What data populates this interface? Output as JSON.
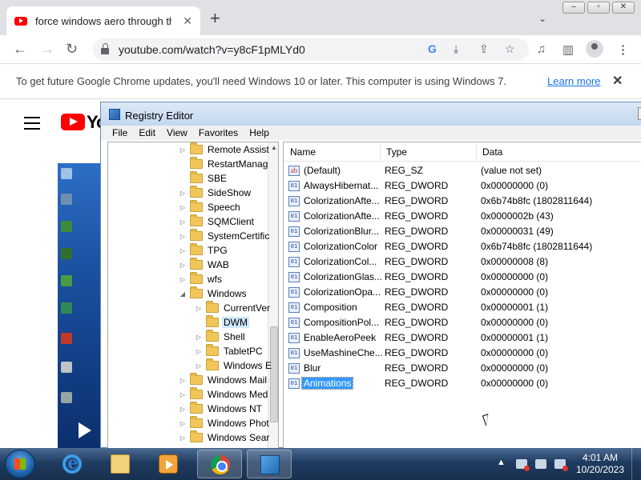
{
  "browser": {
    "tab_title": "force windows aero through the",
    "tab_close": "✕",
    "new_tab": "+",
    "url": "youtube.com/watch?v=y8cF1pMLYd0",
    "infobar_text": "To get future Google Chrome updates, you'll need Windows 10 or later. This computer is using Windows 7.",
    "infobar_link": "Learn more",
    "infobar_close": "✕"
  },
  "youtube": {
    "logo_text": "Yo"
  },
  "regedit": {
    "title": "Registry Editor",
    "menu": [
      "File",
      "Edit",
      "View",
      "Favorites",
      "Help"
    ],
    "tree": [
      {
        "label": "Remote Assist",
        "indent": 0,
        "arrow": "▷"
      },
      {
        "label": "RestartManag",
        "indent": 0,
        "arrow": ""
      },
      {
        "label": "SBE",
        "indent": 0,
        "arrow": ""
      },
      {
        "label": "SideShow",
        "indent": 0,
        "arrow": "▷"
      },
      {
        "label": "Speech",
        "indent": 0,
        "arrow": "▷"
      },
      {
        "label": "SQMClient",
        "indent": 0,
        "arrow": "▷"
      },
      {
        "label": "SystemCertific",
        "indent": 0,
        "arrow": "▷"
      },
      {
        "label": "TPG",
        "indent": 0,
        "arrow": "▷"
      },
      {
        "label": "WAB",
        "indent": 0,
        "arrow": "▷"
      },
      {
        "label": "wfs",
        "indent": 0,
        "arrow": "▷"
      },
      {
        "label": "Windows",
        "indent": 0,
        "arrow": "◢"
      },
      {
        "label": "CurrentVer",
        "indent": 1,
        "arrow": "▷"
      },
      {
        "label": "DWM",
        "indent": 1,
        "arrow": "",
        "selected": true
      },
      {
        "label": "Shell",
        "indent": 1,
        "arrow": "▷"
      },
      {
        "label": "TabletPC",
        "indent": 1,
        "arrow": "▷"
      },
      {
        "label": "Windows E",
        "indent": 1,
        "arrow": "▷"
      },
      {
        "label": "Windows Mail",
        "indent": 0,
        "arrow": "▷"
      },
      {
        "label": "Windows Med",
        "indent": 0,
        "arrow": "▷"
      },
      {
        "label": "Windows NT",
        "indent": 0,
        "arrow": "▷"
      },
      {
        "label": "Windows Phot",
        "indent": 0,
        "arrow": "▷"
      },
      {
        "label": "Windows Sear",
        "indent": 0,
        "arrow": "▷"
      }
    ],
    "columns": [
      "Name",
      "Type",
      "Data"
    ],
    "values": [
      {
        "name": "(Default)",
        "type": "REG_SZ",
        "data": "(value not set)",
        "icon": "ab"
      },
      {
        "name": "AlwaysHibernat...",
        "type": "REG_DWORD",
        "data": "0x00000000 (0)",
        "icon": "01"
      },
      {
        "name": "ColorizationAfte...",
        "type": "REG_DWORD",
        "data": "0x6b74b8fc (1802811644)",
        "icon": "01"
      },
      {
        "name": "ColorizationAfte...",
        "type": "REG_DWORD",
        "data": "0x0000002b (43)",
        "icon": "01"
      },
      {
        "name": "ColorizationBlur...",
        "type": "REG_DWORD",
        "data": "0x00000031 (49)",
        "icon": "01"
      },
      {
        "name": "ColorizationColor",
        "type": "REG_DWORD",
        "data": "0x6b74b8fc (1802811644)",
        "icon": "01"
      },
      {
        "name": "ColorizationCol...",
        "type": "REG_DWORD",
        "data": "0x00000008 (8)",
        "icon": "01"
      },
      {
        "name": "ColorizationGlas...",
        "type": "REG_DWORD",
        "data": "0x00000000 (0)",
        "icon": "01"
      },
      {
        "name": "ColorizationOpa...",
        "type": "REG_DWORD",
        "data": "0x00000000 (0)",
        "icon": "01"
      },
      {
        "name": "Composition",
        "type": "REG_DWORD",
        "data": "0x00000001 (1)",
        "icon": "01"
      },
      {
        "name": "CompositionPol...",
        "type": "REG_DWORD",
        "data": "0x00000000 (0)",
        "icon": "01"
      },
      {
        "name": "EnableAeroPeek",
        "type": "REG_DWORD",
        "data": "0x00000001 (1)",
        "icon": "01"
      },
      {
        "name": "UseMashineChe...",
        "type": "REG_DWORD",
        "data": "0x00000000 (0)",
        "icon": "01"
      },
      {
        "name": "Blur",
        "type": "REG_DWORD",
        "data": "0x00000000 (0)",
        "icon": "01"
      },
      {
        "name": "Animations",
        "type": "REG_DWORD",
        "data": "0x00000000 (0)",
        "icon": "01",
        "selected": true
      }
    ]
  },
  "taskbar": {
    "time": "4:01 AM",
    "date": "10/20/2023"
  },
  "colors": {
    "accent": "#3399ff",
    "yt_red": "#ff0000",
    "link": "#1a73e8"
  }
}
